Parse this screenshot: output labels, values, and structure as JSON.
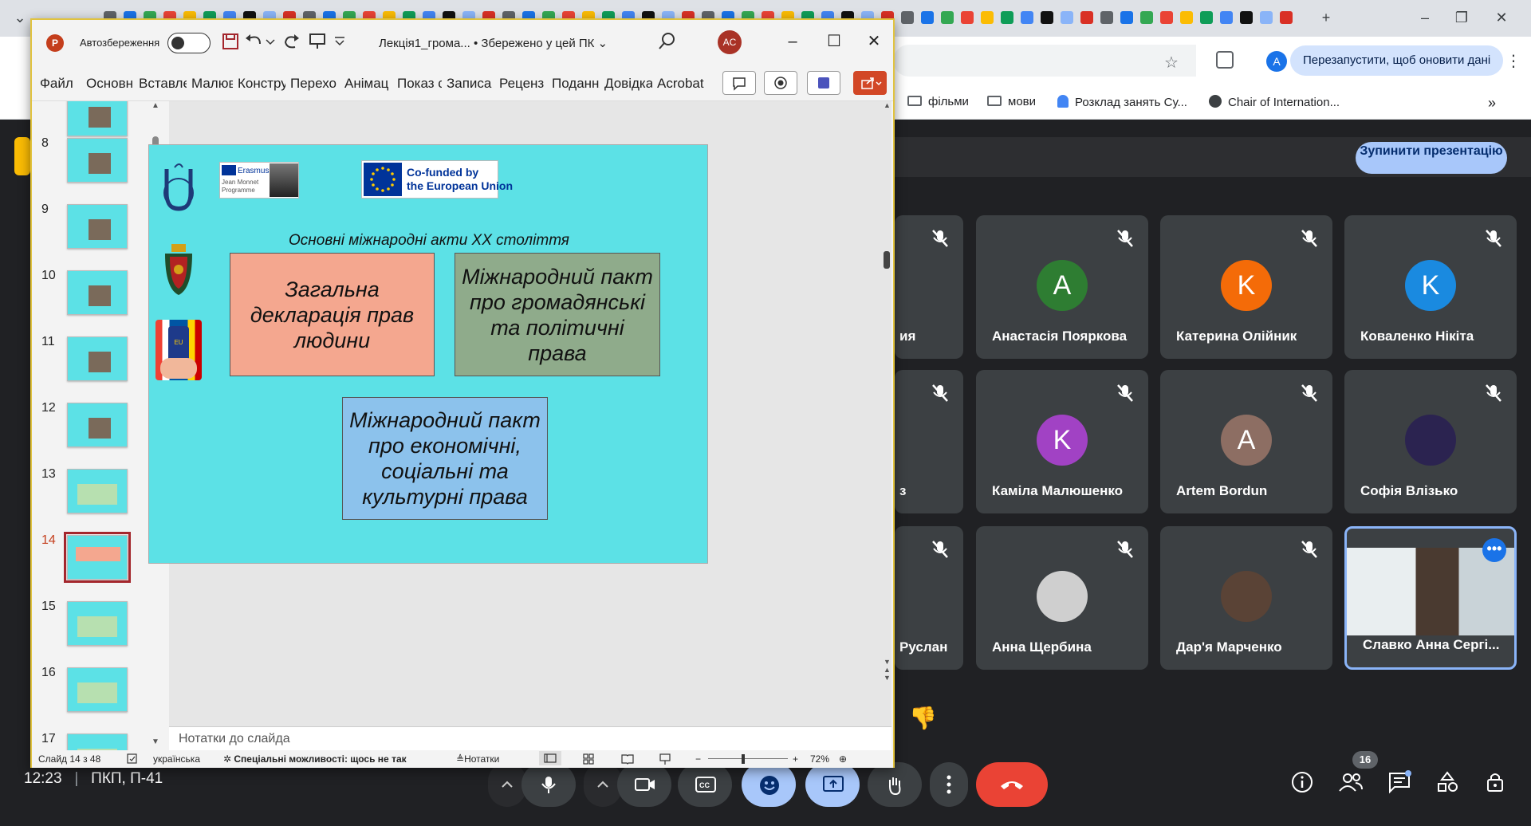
{
  "browser": {
    "relaunch_label": "Перезапустити, щоб оновити дані",
    "profile_initial": "A",
    "bookmarks": [
      {
        "label": "фільми"
      },
      {
        "label": "мови"
      },
      {
        "label": "Розклад занять Су..."
      },
      {
        "label": "Chair of Internation..."
      }
    ]
  },
  "meet": {
    "stop_presenting_label": "Зупинити презентацію",
    "participants": [
      {
        "name": "ия",
        "initial": "",
        "color": "#3c4043"
      },
      {
        "name": "Анастасія Пояркова",
        "initial": "A",
        "color": "#2e7d32"
      },
      {
        "name": "Катерина Олійник",
        "initial": "K",
        "color": "#f46b08"
      },
      {
        "name": "Коваленко Нікіта",
        "initial": "K",
        "color": "#1a8ae0"
      },
      {
        "name": "з",
        "initial": "",
        "color": "#3c4043"
      },
      {
        "name": "Каміла Малюшенко",
        "initial": "K",
        "color": "#a142c4"
      },
      {
        "name": "Artem Bordun",
        "initial": "A",
        "color": "#8d6e63"
      },
      {
        "name": "Софія Влізько",
        "initial": "",
        "color": "#2b2350"
      },
      {
        "name": "Руслан",
        "initial": "",
        "color": "#3c4043"
      },
      {
        "name": "Анна Щербина",
        "initial": "",
        "color": "#cfcfcf"
      },
      {
        "name": "Дар'я Марченко",
        "initial": "",
        "color": "#5a4336"
      },
      {
        "name": "Славко Анна Сергі...",
        "initial": "",
        "color": "#9a8f7c"
      }
    ],
    "time": "12:23",
    "meeting_code": "ПКП, П-41",
    "participants_count": "16"
  },
  "ppt": {
    "autosave_label": "Автозбереження",
    "doc_title": "Лекція1_грома...  •  Збережено у цей ПК",
    "user_initials": "AC",
    "tabs": [
      "Файл",
      "Основн",
      "Вставле",
      "Малюв",
      "Констру",
      "Перехо",
      "Анімац",
      "Показ с",
      "Записа",
      "Реценз",
      "Подання",
      "Довідка",
      "Acrobat"
    ],
    "thumbnails": [
      {
        "num": "8"
      },
      {
        "num": "9"
      },
      {
        "num": "10"
      },
      {
        "num": "11"
      },
      {
        "num": "12"
      },
      {
        "num": "13"
      },
      {
        "num": "14"
      },
      {
        "num": "15"
      },
      {
        "num": "16"
      },
      {
        "num": "17"
      }
    ],
    "selected_slide": "14",
    "notes_placeholder": "Нотатки до слайда",
    "status": {
      "slide": "Слайд 14 з 48",
      "language": "українська",
      "accessibility": "Спеціальні можливості: щось не так",
      "notes_label": "Нотатки",
      "zoom": "72%"
    },
    "slide": {
      "erasmus_text": "Erasmus+",
      "erasmus_sub": "Jean Monnet Programme",
      "cofunded_line1": "Co-funded by",
      "cofunded_line2": "the European Union",
      "heading": "Основні міжнародні акти XX століття",
      "box1": "Загальна декларація прав людини",
      "box2": "Міжнародний пакт про громадянські та політичні права",
      "box3": "Міжнародний пакт про економічні, соціальні та культурні права",
      "eu_badge": "EU"
    }
  }
}
